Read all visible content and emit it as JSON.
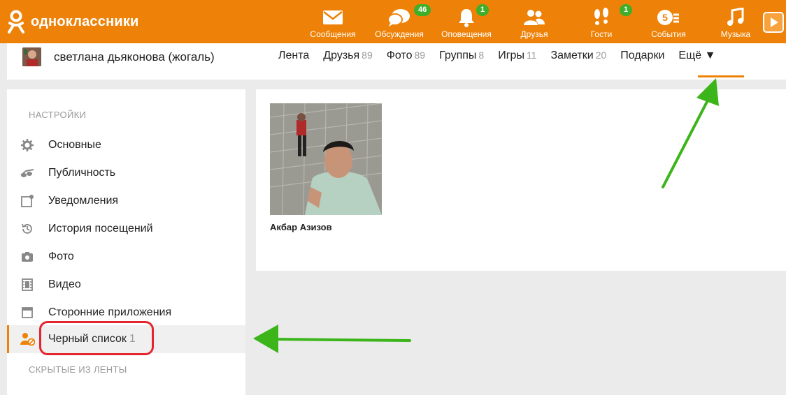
{
  "header": {
    "logo_text": "одноклассники",
    "nav": [
      {
        "label": "Сообщения",
        "icon": "envelope-icon",
        "badge": ""
      },
      {
        "label": "Обсуждения",
        "icon": "chat-bubbles-icon",
        "badge": "46"
      },
      {
        "label": "Оповещения",
        "icon": "bell-icon",
        "badge": "1"
      },
      {
        "label": "Друзья",
        "icon": "friends-icon",
        "badge": ""
      },
      {
        "label": "Гости",
        "icon": "footprints-icon",
        "badge": "1"
      },
      {
        "label": "События",
        "icon": "events-icon",
        "badge": ""
      },
      {
        "label": "Музыка",
        "icon": "music-note-icon",
        "badge": ""
      }
    ],
    "accent": "#ee8208",
    "badge_color": "#3fae29"
  },
  "profile": {
    "name": "светлана дьяконова (жогаль)",
    "tabs": [
      {
        "label": "Лента",
        "count": ""
      },
      {
        "label": "Друзья",
        "count": "89"
      },
      {
        "label": "Фото",
        "count": "89"
      },
      {
        "label": "Группы",
        "count": "8"
      },
      {
        "label": "Игры",
        "count": "11"
      },
      {
        "label": "Заметки",
        "count": "20"
      },
      {
        "label": "Подарки",
        "count": ""
      },
      {
        "label": "Ещё ▼",
        "count": ""
      }
    ]
  },
  "sidebar": {
    "section_title": "НАСТРОЙКИ",
    "items": [
      {
        "label": "Основные",
        "icon": "gear-icon",
        "count": ""
      },
      {
        "label": "Публичность",
        "icon": "glasses-icon",
        "count": ""
      },
      {
        "label": "Уведомления",
        "icon": "notification-icon",
        "count": ""
      },
      {
        "label": "История посещений",
        "icon": "history-icon",
        "count": ""
      },
      {
        "label": "Фото",
        "icon": "camera-icon",
        "count": ""
      },
      {
        "label": "Видео",
        "icon": "film-icon",
        "count": ""
      },
      {
        "label": "Сторонние приложения",
        "icon": "app-window-icon",
        "count": ""
      },
      {
        "label": "Черный список",
        "icon": "blocked-user-icon",
        "count": "1"
      }
    ],
    "hidden_section_title": "СКРЫТЫЕ ИЗ ЛЕНТЫ"
  },
  "content": {
    "blocked_user_name": "Акбар Азизов"
  },
  "annotation_colors": {
    "arrow": "#3bb51a",
    "highlight_box": "#e3262e"
  }
}
